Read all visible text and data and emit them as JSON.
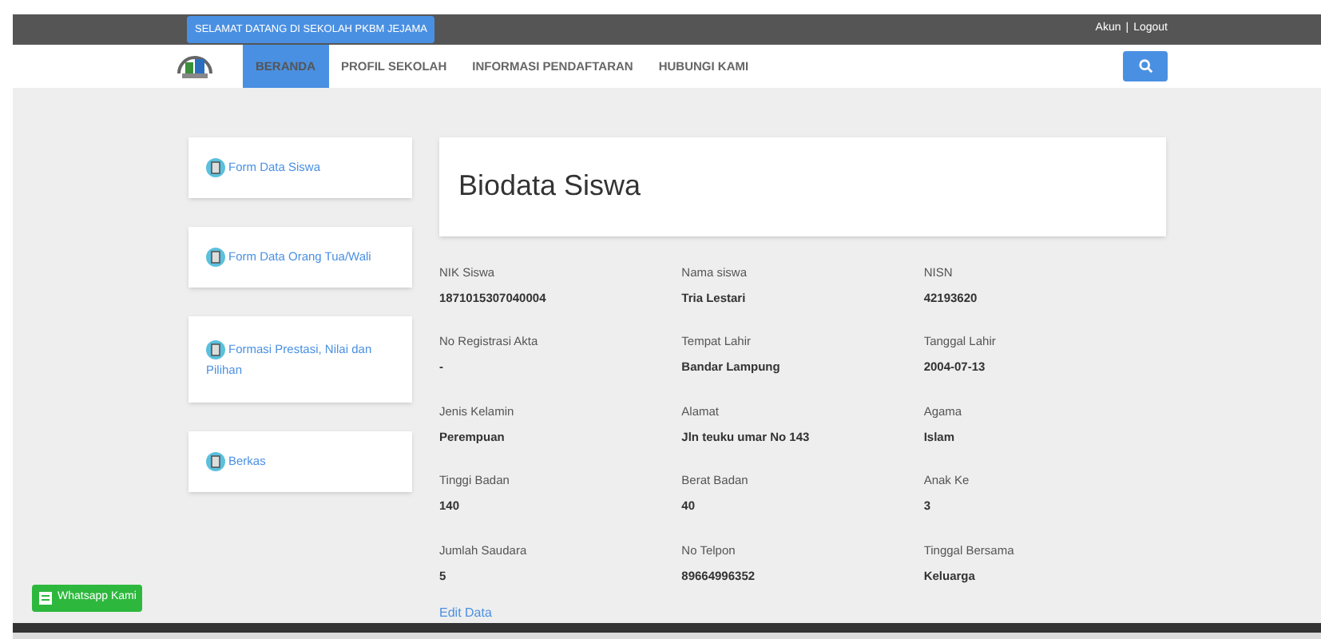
{
  "top_bar": {
    "welcome": "SELAMAT DATANG DI SEKOLAH PKBM JEJAMA",
    "links": [
      "Akun",
      "|",
      "Logout"
    ]
  },
  "nav": {
    "items": [
      {
        "label": "BERANDA",
        "selected": true
      },
      {
        "label": "PROFIL SEKOLAH",
        "selected": false
      },
      {
        "label": "INFORMASI PENDAFTARAN",
        "selected": false
      },
      {
        "label": "HUBUNGI KAMI",
        "selected": false
      }
    ]
  },
  "sidebar": {
    "items": [
      {
        "label": "Form Data Siswa"
      },
      {
        "label": "Form Data Orang Tua/Wali"
      },
      {
        "label": "Formasi Prestasi, Nilai dan Pilihan"
      },
      {
        "label": "Berkas"
      }
    ]
  },
  "main": {
    "title": "Biodata Siswa",
    "fields": [
      {
        "label": "NIK Siswa",
        "value": "1871015307040004"
      },
      {
        "label": "Nama siswa",
        "value": "Tria Lestari"
      },
      {
        "label": "NISN",
        "value": "42193620"
      },
      {
        "label": "No Registrasi Akta",
        "value": "-"
      },
      {
        "label": "Tempat Lahir",
        "value": "Bandar Lampung"
      },
      {
        "label": "Tanggal Lahir",
        "value": "2004-07-13"
      },
      {
        "label": "Jenis Kelamin",
        "value": "Perempuan"
      },
      {
        "label": "Alamat",
        "value": "Jln teuku umar No 143"
      },
      {
        "label": "Agama",
        "value": "Islam"
      },
      {
        "label": "Tinggi Badan",
        "value": "140"
      },
      {
        "label": "Berat Badan",
        "value": "40"
      },
      {
        "label": "Anak Ke",
        "value": "3"
      },
      {
        "label": "Jumlah Saudara",
        "value": "5"
      },
      {
        "label": "No Telpon",
        "value": "89664996352"
      },
      {
        "label": "Tinggal Bersama",
        "value": "Keluarga"
      }
    ],
    "edit_link": "Edit Data"
  },
  "whatsapp_button": "Whatsapp Kami"
}
